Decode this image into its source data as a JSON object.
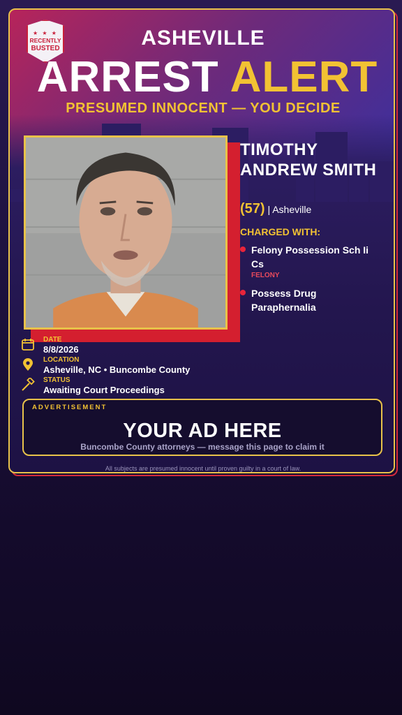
{
  "brand": {
    "badge_line1": "RECENTLY",
    "badge_line2": "BUSTED",
    "badge_stars": "★ ★ ★"
  },
  "header": {
    "city": "ASHEVILLE",
    "headline_part1": "ARREST",
    "headline_part2": "ALERT",
    "tagline": "PRESUMED INNOCENT — YOU DECIDE"
  },
  "subject": {
    "name": "TIMOTHY ANDREW SMITH",
    "age": "(57)",
    "location_suffix": "| Asheville",
    "photo_icon": "mugshot-photo"
  },
  "charges": {
    "title": "CHARGED WITH:",
    "items": [
      {
        "text": "Felony Possession Sch Ii Cs",
        "severity": "FELONY"
      },
      {
        "text": "Possess Drug Paraphernalia",
        "severity": ""
      }
    ]
  },
  "details": {
    "date_label": "DATE",
    "date_value": "8/8/2026",
    "date_icon": "calendar-icon",
    "location_label": "LOCATION",
    "location_value": "Asheville, NC • Buncombe County",
    "location_icon": "map-pin-icon",
    "status_label": "STATUS",
    "status_value": "Awaiting Court Proceedings",
    "status_icon": "gavel-icon"
  },
  "ad": {
    "label": "ADVERTISEMENT",
    "title": "YOUR AD HERE",
    "subtitle": "Buncombe County attorneys — message this page to claim it"
  },
  "footer": {
    "disclaimer": "All subjects are presumed innocent until proven guilty in a court of law."
  },
  "colors": {
    "accent_gold": "#f2c233",
    "alert_red": "#d41f2f",
    "card_border": "#e8c24a"
  }
}
